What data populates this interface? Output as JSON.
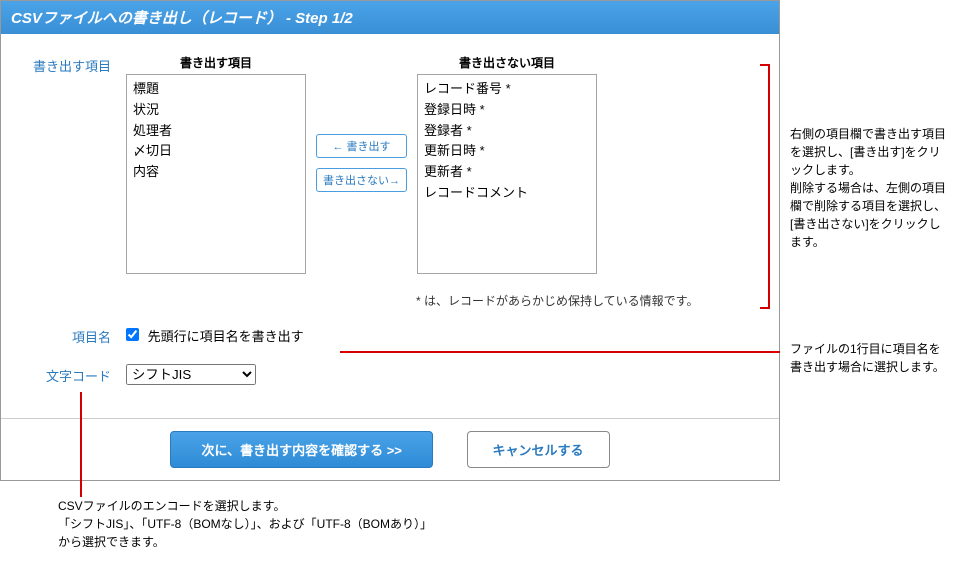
{
  "header": {
    "title": "CSVファイルへの書き出し（レコード） - Step 1/2"
  },
  "labels": {
    "export_items": "書き出す項目",
    "item_name": "項目名",
    "charset": "文字コード"
  },
  "dualList": {
    "leftHeader": "書き出す項目",
    "rightHeader": "書き出さない項目",
    "leftItems": [
      "標題",
      "状況",
      "処理者",
      "〆切日",
      "内容"
    ],
    "rightItems": [
      "レコード番号 *",
      "登録日時 *",
      "登録者 *",
      "更新日時 *",
      "更新者 *",
      "レコードコメント"
    ],
    "includeBtn": "← 書き出す",
    "excludeBtn": "書き出さない→",
    "footnote": "* は、レコードがあらかじめ保持している情報です。"
  },
  "itemName": {
    "checkboxLabel": "先頭行に項目名を書き出す"
  },
  "charset": {
    "selected": "シフトJIS"
  },
  "buttons": {
    "next": "次に、書き出す内容を確認する >>",
    "cancel": "キャンセルする"
  },
  "annotations": {
    "right1": "右側の項目欄で書き出す項目を選択し、[書き出す]をクリックします。\n削除する場合は、左側の項目欄で削除する項目を選択し、[書き出さない]をクリックします。",
    "right2": "ファイルの1行目に項目名を書き出す場合に選択します。",
    "bottom": "CSVファイルのエンコードを選択します。\n「シフトJIS」、「UTF-8（BOMなし）」、および「UTF-8（BOMあり）」から選択できます。"
  }
}
